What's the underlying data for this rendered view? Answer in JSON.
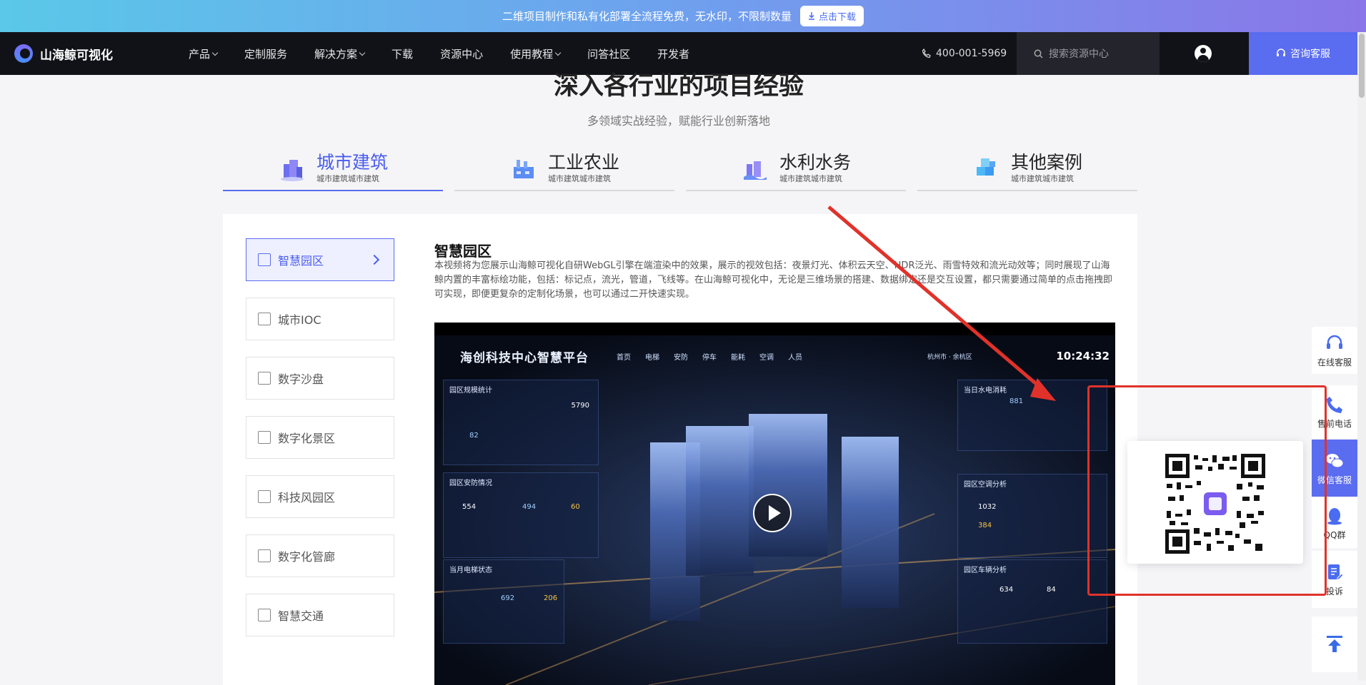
{
  "banner": {
    "text": "二维项目制作和私有化部署全流程免费，无水印，不限制数量",
    "button": "点击下载"
  },
  "nav": {
    "brand": "山海鲸可视化",
    "items": [
      {
        "label": "产品",
        "dropdown": true
      },
      {
        "label": "定制服务",
        "dropdown": false
      },
      {
        "label": "解决方案",
        "dropdown": true
      },
      {
        "label": "下载",
        "dropdown": false
      },
      {
        "label": "资源中心",
        "dropdown": false
      },
      {
        "label": "使用教程",
        "dropdown": true
      },
      {
        "label": "问答社区",
        "dropdown": false
      },
      {
        "label": "开发者",
        "dropdown": false
      }
    ],
    "phone": "400-001-5969",
    "search_placeholder": "搜索资源中心",
    "consult": "咨询客服"
  },
  "section": {
    "title": "深入各行业的项目经验",
    "subtitle": "多领域实战经验，赋能行业创新落地"
  },
  "tabs": [
    {
      "title": "城市建筑",
      "sub": "城市建筑城市建筑",
      "icon": "city-building-icon"
    },
    {
      "title": "工业农业",
      "sub": "城市建筑城市建筑",
      "icon": "factory-icon"
    },
    {
      "title": "水利水务",
      "sub": "城市建筑城市建筑",
      "icon": "water-icon"
    },
    {
      "title": "其他案例",
      "sub": "城市建筑城市建筑",
      "icon": "cubes-icon"
    }
  ],
  "sidebar": [
    {
      "label": "智慧园区",
      "active": true
    },
    {
      "label": "城市IOC"
    },
    {
      "label": "数字沙盘"
    },
    {
      "label": "数字化景区"
    },
    {
      "label": "科技风园区"
    },
    {
      "label": "数字化管廊"
    },
    {
      "label": "智慧交通"
    }
  ],
  "content": {
    "title": "智慧园区",
    "desc": "本视频将为您展示山海鲸可视化自研WebGL引擎在端渲染中的效果，展示的视效包括：夜景灯光、体积云天空、HDR泛光、雨雪特效和流光动效等；同时展现了山海鲸内置的丰富标绘功能，包括：标记点，流光，管道，飞线等。在山海鲸可视化中，无论是三维场景的搭建、数据绑定还是交互设置，都只需要通过简单的点击拖拽即可实现，即便更复杂的定制化场景，也可以通过二开快速实现。"
  },
  "video": {
    "title": "海创科技中心智慧平台",
    "tabs": [
      "首页",
      "电梯",
      "安防",
      "停车",
      "能耗",
      "空调",
      "人员"
    ],
    "location": "杭州市 · 余杭区",
    "time": "10:24:32",
    "panels": {
      "stats": "园区规模统计",
      "security": "园区安防情况",
      "elevator": "当月电梯状态",
      "water": "当日水电消耗",
      "aircon": "园区空调分析",
      "parking": "园区车辆分析"
    },
    "values": [
      "5790",
      "82",
      "554",
      "494",
      "60",
      "692",
      "206",
      "881",
      "1032",
      "384",
      "634",
      "84"
    ]
  },
  "float_bar": [
    {
      "label": "在线客服",
      "icon": "headset-icon"
    },
    {
      "label": "售前电话",
      "icon": "phone-icon"
    },
    {
      "label": "微信客服",
      "icon": "wechat-icon",
      "active": true
    },
    {
      "label": "QQ群",
      "icon": "qq-icon"
    },
    {
      "label": "投诉",
      "icon": "complaint-icon"
    }
  ],
  "colors": {
    "accent": "#5a6cf0",
    "nav_bg": "#111218",
    "annotation": "#e0322a"
  }
}
